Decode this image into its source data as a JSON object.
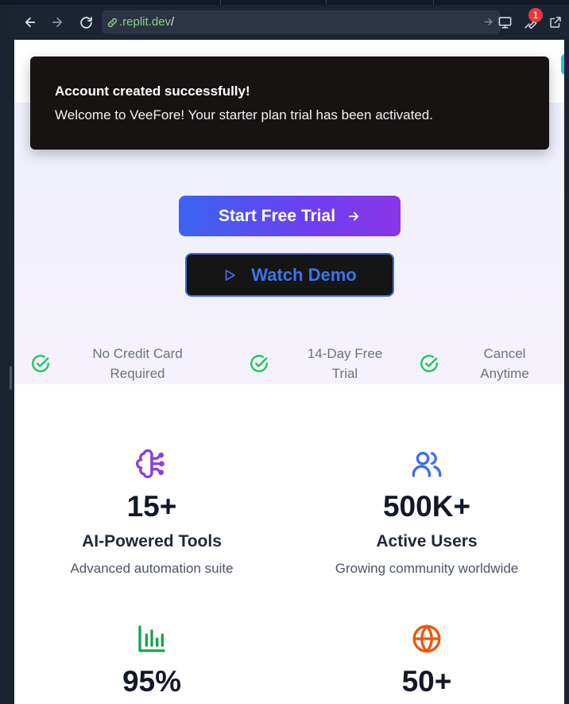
{
  "browser": {
    "url_host": ".replit.dev",
    "url_path": "/",
    "notification_count": "1"
  },
  "hero": {
    "primary_cta": "Start Free Trial",
    "demo_cta": "Watch Demo",
    "features": [
      {
        "line1": "No Credit Card",
        "line2": "Required"
      },
      {
        "line1": "14-Day Free",
        "line2": "Trial"
      },
      {
        "line1": "Cancel",
        "line2": "Anytime"
      }
    ]
  },
  "stats": [
    {
      "value": "15+",
      "title": "AI-Powered Tools",
      "description": "Advanced automation suite",
      "icon": "brain-circuit-icon",
      "color": "#8b3fd9"
    },
    {
      "value": "500K+",
      "title": "Active Users",
      "description": "Growing community worldwide",
      "icon": "users-icon",
      "color": "#3b6ef0"
    },
    {
      "value": "95%",
      "title": "",
      "description": "",
      "icon": "bar-chart-icon",
      "color": "#16a34a"
    },
    {
      "value": "50+",
      "title": "",
      "description": "",
      "icon": "globe-icon",
      "color": "#ea580c"
    }
  ],
  "toast": {
    "title": "Account created successfully!",
    "message": "Welcome to VeeFore! Your starter plan trial has been activated."
  },
  "colors": {
    "check_green": "#22c55e",
    "demo_blue": "#3b74f0",
    "toast_bg": "#171312"
  }
}
